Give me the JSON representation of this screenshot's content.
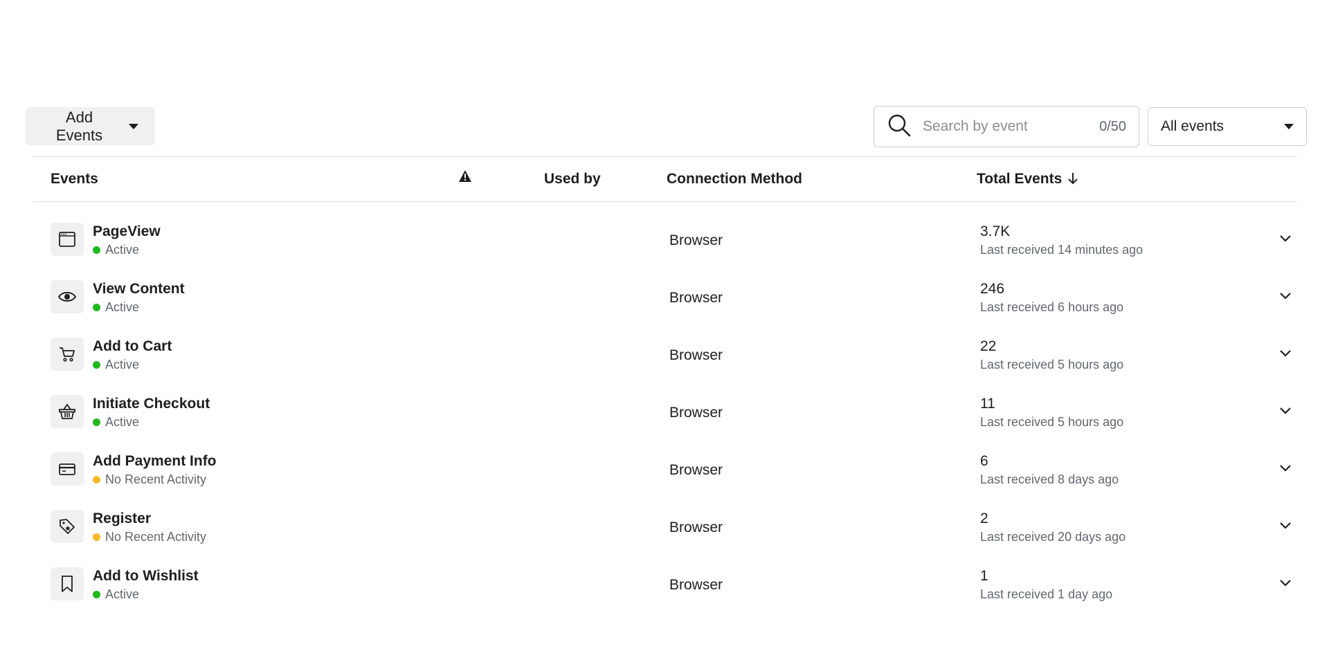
{
  "toolbar": {
    "add_events_label": "Add Events",
    "search_placeholder": "Search by event",
    "search_value": "",
    "search_counter": "0/50",
    "filter_selected": "All events"
  },
  "table": {
    "headers": {
      "events": "Events",
      "used_by": "Used by",
      "connection_method": "Connection Method",
      "total_events": "Total Events"
    },
    "rows": [
      {
        "name": "PageView",
        "icon": "browser-window-icon",
        "status": "Active",
        "status_color": "#1db91d",
        "method": "Browser",
        "total": "3.7K",
        "last_received": "Last received 14 minutes ago"
      },
      {
        "name": "View Content",
        "icon": "eye-icon",
        "status": "Active",
        "status_color": "#1db91d",
        "method": "Browser",
        "total": "246",
        "last_received": "Last received 6 hours ago"
      },
      {
        "name": "Add to Cart",
        "icon": "cart-icon",
        "status": "Active",
        "status_color": "#1db91d",
        "method": "Browser",
        "total": "22",
        "last_received": "Last received 5 hours ago"
      },
      {
        "name": "Initiate Checkout",
        "icon": "basket-icon",
        "status": "Active",
        "status_color": "#1db91d",
        "method": "Browser",
        "total": "11",
        "last_received": "Last received 5 hours ago"
      },
      {
        "name": "Add Payment Info",
        "icon": "credit-card-icon",
        "status": "No Recent Activity",
        "status_color": "#f7b928",
        "method": "Browser",
        "total": "6",
        "last_received": "Last received 8 days ago"
      },
      {
        "name": "Register",
        "icon": "tag-icon",
        "status": "No Recent Activity",
        "status_color": "#f7b928",
        "method": "Browser",
        "total": "2",
        "last_received": "Last received 20 days ago"
      },
      {
        "name": "Add to Wishlist",
        "icon": "bookmark-icon",
        "status": "Active",
        "status_color": "#1db91d",
        "method": "Browser",
        "total": "1",
        "last_received": "Last received 1 day ago"
      }
    ]
  }
}
